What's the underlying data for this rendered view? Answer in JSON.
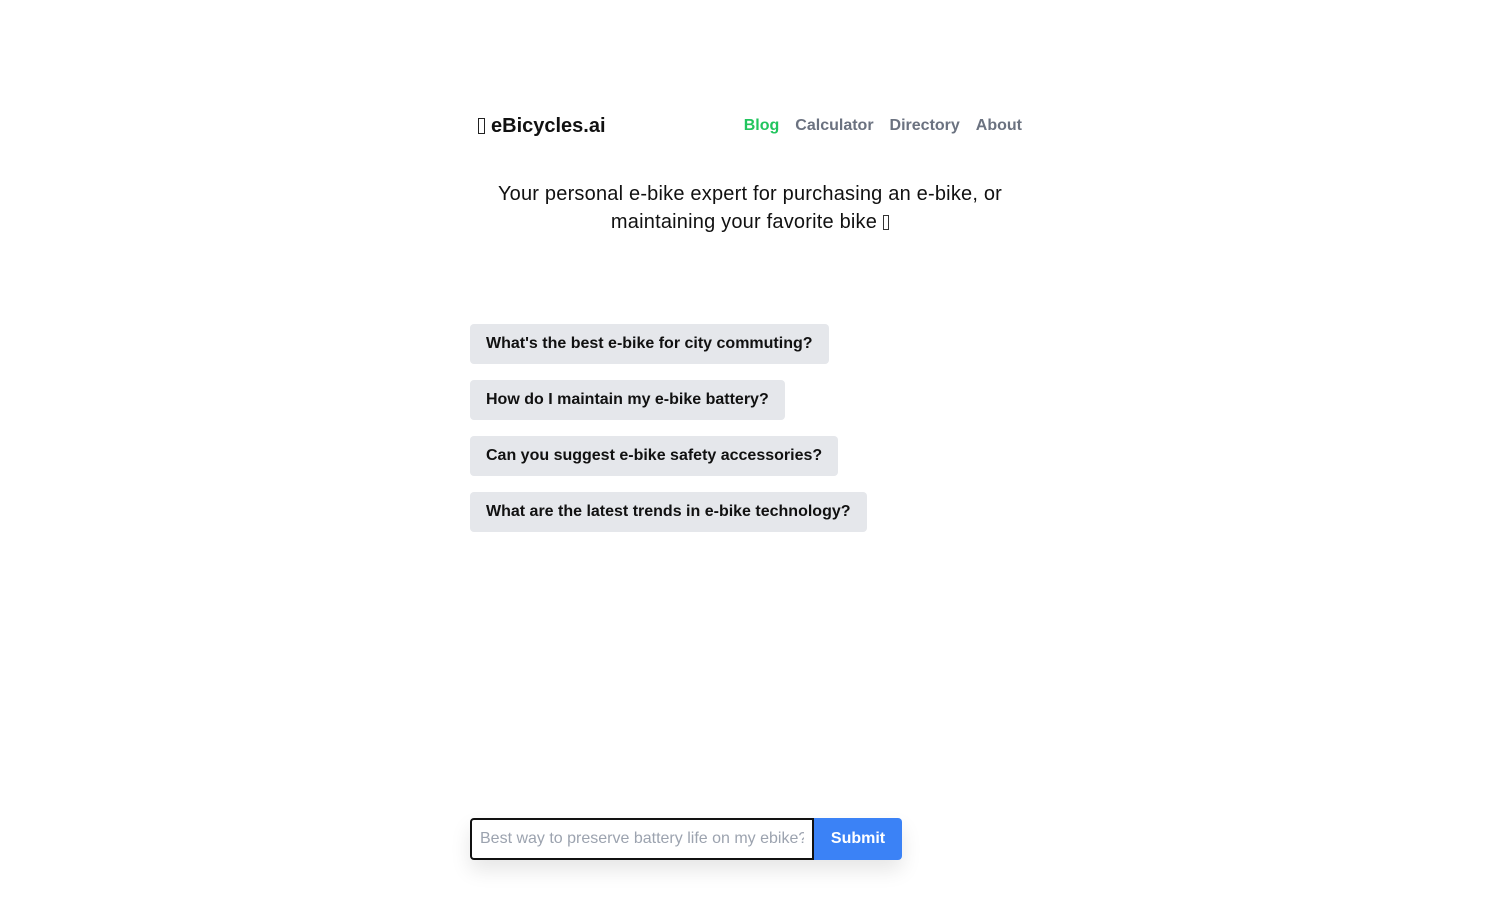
{
  "header": {
    "logo_icon": "bicycle-emoji-icon",
    "logo_text": "eBicycles.ai",
    "nav": [
      {
        "label": "Blog",
        "active": true
      },
      {
        "label": "Calculator",
        "active": false
      },
      {
        "label": "Directory",
        "active": false
      },
      {
        "label": "About",
        "active": false
      }
    ]
  },
  "tagline": {
    "line1": "Your personal e-bike expert for purchasing an e-bike, or",
    "line2": "maintaining your favorite bike",
    "trailing_icon": "emoji-icon"
  },
  "suggestions": [
    "What's the best e-bike for city commuting?",
    "How do I maintain my e-bike battery?",
    "Can you suggest e-bike safety accessories?",
    "What are the latest trends in e-bike technology?"
  ],
  "form": {
    "value": "",
    "placeholder": "Best way to preserve battery life on my ebike?",
    "submit_label": "Submit"
  },
  "colors": {
    "accent_green": "#22c55e",
    "nav_gray": "#6b7280",
    "suggestion_bg": "#e5e7eb",
    "submit_blue": "#3b82f6"
  }
}
